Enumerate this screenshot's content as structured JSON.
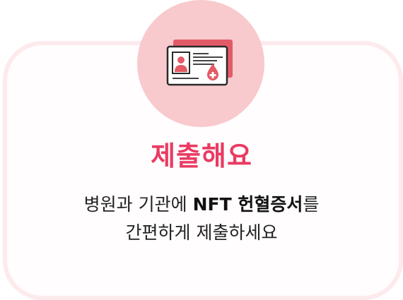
{
  "colors": {
    "accent": "#ea3b63",
    "circle": "#f8c9cd",
    "card_border": "#fdeaec",
    "icon_red": "#e35b66",
    "text": "#222222"
  },
  "icon": {
    "name": "nft-blood-donation-certificate-icon"
  },
  "title": "제출해요",
  "description": {
    "line1_prefix": "병원과 기관에 ",
    "line1_strong": "NFT 헌혈증서",
    "line1_suffix": "를",
    "line2": "간편하게 제출하세요"
  }
}
